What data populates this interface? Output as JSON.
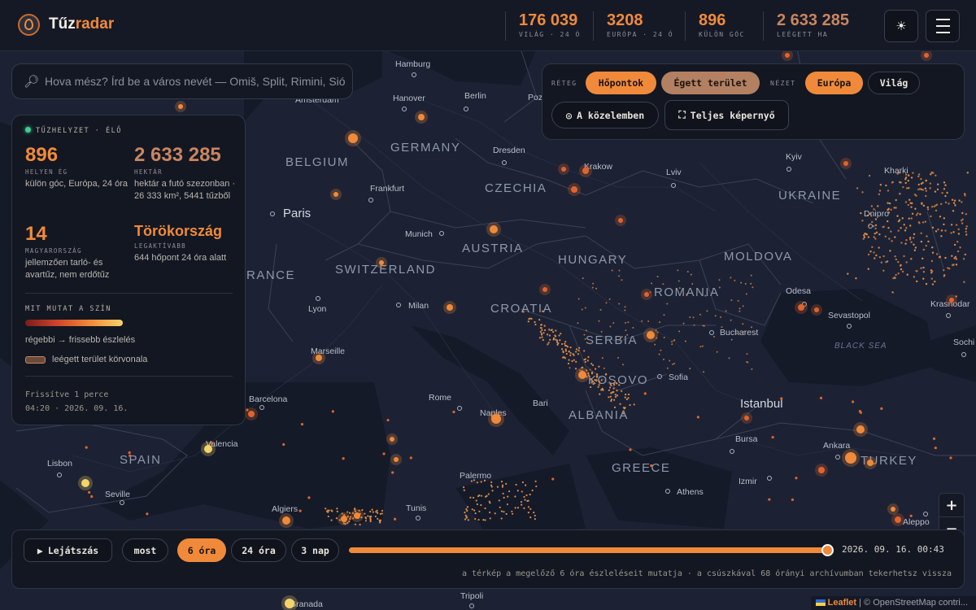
{
  "brand": {
    "part1": "Tűz",
    "part2": "radar"
  },
  "header_stats": [
    {
      "value": "176 039",
      "label": "VILÁG · 24 Ó"
    },
    {
      "value": "3208",
      "label": "EURÓPA · 24 Ó"
    },
    {
      "value": "896",
      "label": "KÜLÖN GÓC"
    },
    {
      "value": "2 633 285",
      "label": "LEÉGETT HA"
    }
  ],
  "header_buttons": {
    "theme": "☀",
    "menu": "menu-icon"
  },
  "search": {
    "placeholder": "Hova mész? Írd be a város nevét — Omiš, Split, Rimini, Sió"
  },
  "status": {
    "live_label": "TŰZHELYZET · ÉLŐ",
    "burning": {
      "value": "896",
      "key": "HELYEN ÉG",
      "desc": "külön góc, Európa, 24 óra"
    },
    "hectares": {
      "value": "2 633 285",
      "key": "HEKTÁR",
      "desc": "hektár a futó szezonban · 26 333 km², 5441 tűzből"
    },
    "hungary": {
      "value": "14",
      "key": "MAGYARORSZÁG",
      "desc": "jellemzően tarló- és avartűz, nem erdőtűz"
    },
    "most_active": {
      "value": "Törökország",
      "key": "LEGAKTÍVABB",
      "desc": "644 hőpont 24 óra alatt"
    },
    "legend_title": "MIT MUTAT A SZÍN",
    "legend_gradient": "régebbi → frissebb észlelés",
    "legend_burn": "leégett terület körvonala",
    "updated": "Frissítve 1 perce",
    "updated_time": "04:20 · 2026. 09. 16."
  },
  "layers": {
    "layer_label": "RÉTEG",
    "layer_hotspots": "Hőpontok",
    "layer_burned": "Égett terület",
    "view_label": "NÉZET",
    "view_europe": "Európa",
    "view_world": "Világ",
    "nearby": "A közelemben",
    "fullscreen": "Teljes képernyő"
  },
  "zoom": {
    "in": "+",
    "out": "−"
  },
  "timeline": {
    "play": "Lejátszás",
    "now": "most",
    "opt_6h": "6 óra",
    "opt_24h": "24 óra",
    "opt_3d": "3 nap",
    "selected": "6 óra",
    "slider_position_fraction": 1.0,
    "date": "2026. 09. 16. 00:43",
    "note": "a térkép a megelőző 6 óra észleléseit mutatja · a csúszkával 68 órányi archívumban tekerhetsz vissza"
  },
  "map": {
    "countries": [
      "GERMANY",
      "BELGIUM",
      "CZECHIA",
      "UKRAINE",
      "AUSTRIA",
      "HUNGARY",
      "MOLDOVA",
      "SWITZERLAND",
      "RANCE",
      "ROMANIA",
      "CROATIA",
      "SERBIA",
      "KOSOVO",
      "ALBANIA",
      "GREECE",
      "SPAIN",
      "TURKEY"
    ],
    "cities": [
      "Hamburg",
      "Hanover",
      "Berlin",
      "Poz",
      "Amsterdam",
      "Dresden",
      "Krakow",
      "Kyiv",
      "Kharki",
      "Frankfurt",
      "Lviv",
      "Dnipro",
      "Munich",
      "Odesa",
      "Lyon",
      "Milan",
      "Bucharest",
      "Sevastopol",
      "Krasnodar",
      "Marseille",
      "Sofia",
      "Sochi",
      "Barcelona",
      "Rome",
      "Bari",
      "Naples",
      "Valencia",
      "Bursa",
      "Ankara",
      "Lisbon",
      "Palermo",
      "Izmir",
      "Seville",
      "Athens",
      "Algiers",
      "Tunis",
      "Aleppo",
      "Tripoli",
      "Granada"
    ],
    "big_cities": [
      "Paris",
      "Istanbul"
    ],
    "sea": "BLACK SEA"
  },
  "attribution": {
    "leaflet": "Leaflet",
    "rest": "| © OpenStreetMap contri..."
  },
  "colors": {
    "accent": "#f08a3a",
    "burn": "#c98560",
    "live": "#3ecf8e",
    "background": "#1c2233"
  }
}
